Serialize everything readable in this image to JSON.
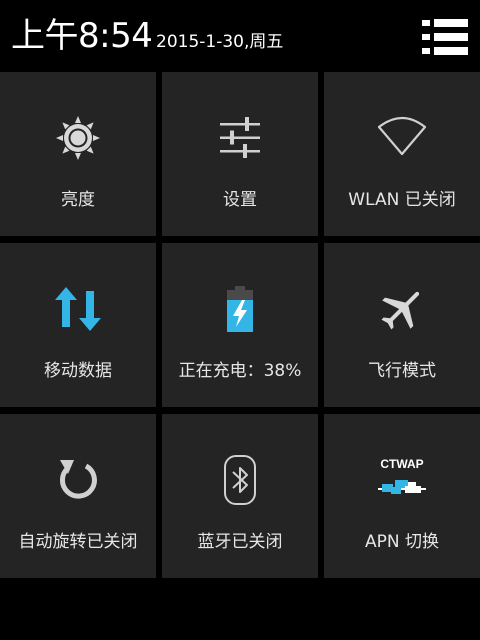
{
  "status": {
    "time": "上午8:54",
    "date": "2015-1-30,周五",
    "menu_icon": "list-settings-icon"
  },
  "tiles": [
    {
      "label": "亮度",
      "icon": "brightness-icon"
    },
    {
      "label": "设置",
      "icon": "settings-sliders-icon"
    },
    {
      "label": "WLAN 已关闭",
      "icon": "wifi-icon"
    },
    {
      "label": "移动数据",
      "icon": "mobile-data-icon"
    },
    {
      "label": "正在充电：38%",
      "icon": "battery-charging-icon"
    },
    {
      "label": "飞行模式",
      "icon": "airplane-icon"
    },
    {
      "label": "自动旋转已关闭",
      "icon": "rotate-icon"
    },
    {
      "label": "蓝牙已关闭",
      "icon": "bluetooth-icon"
    },
    {
      "label": "APN 切换",
      "icon": "apn-network-icon",
      "icon_text": "CTWAP"
    }
  ],
  "colors": {
    "background": "#000000",
    "tile": "#242424",
    "accent_blue": "#33b5e5",
    "icon_gray": "#d0d0d0"
  }
}
